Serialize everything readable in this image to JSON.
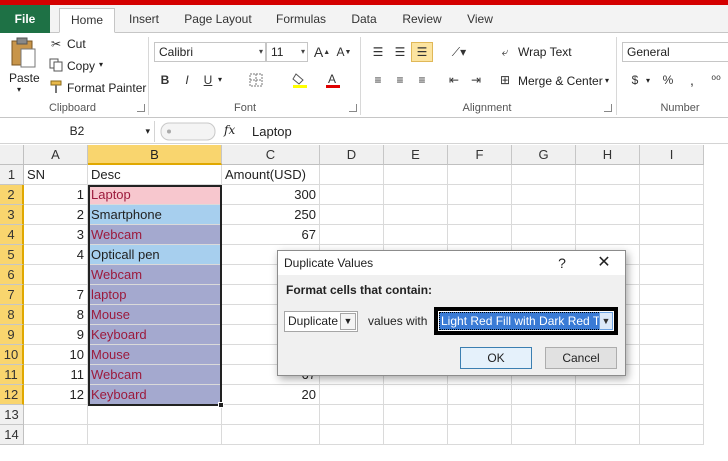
{
  "ribbon": {
    "tabs": [
      "File",
      "Home",
      "Insert",
      "Page Layout",
      "Formulas",
      "Data",
      "Review",
      "View"
    ],
    "clipboard": {
      "paste": "Paste",
      "cut": "Cut",
      "copy": "Copy",
      "format_painter": "Format Painter",
      "label": "Clipboard"
    },
    "font": {
      "name": "Calibri",
      "size": "11",
      "bold": "B",
      "italic": "I",
      "underline": "U",
      "label": "Font"
    },
    "alignment": {
      "wrap": "Wrap Text",
      "merge": "Merge & Center",
      "label": "Alignment"
    },
    "number": {
      "format": "General",
      "currency": "$",
      "percent": "%",
      "comma": ",",
      "label": "Number"
    }
  },
  "formula_bar": {
    "name_box": "B2",
    "fx": "fx",
    "value": "Laptop"
  },
  "columns": [
    "A",
    "B",
    "C",
    "D",
    "E",
    "F",
    "G",
    "H",
    "I"
  ],
  "rows": [
    "1",
    "2",
    "3",
    "4",
    "5",
    "6",
    "7",
    "8",
    "9",
    "10",
    "11",
    "12",
    "13",
    "14"
  ],
  "cells": {
    "header": {
      "a": "SN",
      "b": "Desc",
      "c": "Amount(USD)"
    },
    "data": [
      {
        "a": "1",
        "b": "Laptop",
        "c": "300"
      },
      {
        "a": "2",
        "b": "Smartphone",
        "c": "250"
      },
      {
        "a": "3",
        "b": "Webcam",
        "c": "67"
      },
      {
        "a": "4",
        "b": "Opticall pen",
        "c": ""
      },
      {
        "a": "",
        "b": "Webcam",
        "c": ""
      },
      {
        "a": "7",
        "b": "laptop",
        "c": ""
      },
      {
        "a": "8",
        "b": "Mouse",
        "c": ""
      },
      {
        "a": "9",
        "b": "Keyboard",
        "c": ""
      },
      {
        "a": "10",
        "b": "Mouse",
        "c": ""
      },
      {
        "a": "11",
        "b": "Webcam",
        "c": "67"
      },
      {
        "a": "12",
        "b": "Keyboard",
        "c": "20"
      }
    ]
  },
  "colors": {
    "dup_fill": "#a4a9cf",
    "dup_text": "#9c1a3c",
    "pink_fill": "#f7c7ce",
    "blue_fill": "#a7cfee"
  },
  "dialog": {
    "title": "Duplicate Values",
    "help": "?",
    "close": "✕",
    "heading": "Format cells that contain:",
    "type_value": "Duplicate",
    "values_with": "values with",
    "format_value": "Light Red Fill with Dark Red Text",
    "ok": "OK",
    "cancel": "Cancel"
  }
}
